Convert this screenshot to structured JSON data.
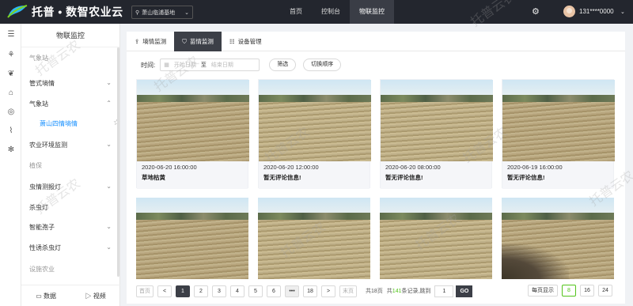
{
  "header": {
    "brand": "托普 • 数智农业云",
    "location": "萧山临浦基地",
    "nav": [
      "首页",
      "控制台",
      "物联监控"
    ],
    "user": "131****0000"
  },
  "sidebar": {
    "title": "物联监控",
    "items": [
      {
        "label": "气象站",
        "muted": true
      },
      {
        "label": "管式墒情",
        "arrow": "down"
      },
      {
        "label": "气象站",
        "arrow": "up"
      },
      {
        "label": "萧山四情墒情",
        "sub": true
      },
      {
        "label": "农业环境监测",
        "arrow": "down"
      },
      {
        "label": "植保",
        "muted": true
      },
      {
        "label": "虫情测报灯",
        "arrow": "down"
      },
      {
        "label": "杀虫灯"
      },
      {
        "label": "智能孢子",
        "arrow": "down"
      },
      {
        "label": "性诱杀虫灯",
        "arrow": "down"
      },
      {
        "label": "设施农业",
        "muted": true
      }
    ],
    "bottom": [
      "数据",
      "视频"
    ]
  },
  "tabs": [
    {
      "label": "墒情监测",
      "icon": "upload-icon"
    },
    {
      "label": "苗情监测",
      "icon": "shield-icon",
      "active": true
    },
    {
      "label": "设备管理",
      "icon": "list-icon"
    }
  ],
  "filter": {
    "time_label": "时间:",
    "start_placeholder": "开始日期",
    "to": "至",
    "end_placeholder": "结束日期",
    "filter_btn": "筛选",
    "order_btn": "切换顺序"
  },
  "cards": [
    {
      "date": "2020-06-20 16:00:00",
      "comment": "草地枯黄"
    },
    {
      "date": "2020-06-20 12:00:00",
      "comment": "暂无评论信息!"
    },
    {
      "date": "2020-06-20 08:00:00",
      "comment": "暂无评论信息!"
    },
    {
      "date": "2020-06-19 16:00:00",
      "comment": "暂无评论信息!"
    },
    {
      "date": "",
      "comment": ""
    },
    {
      "date": "",
      "comment": ""
    },
    {
      "date": "",
      "comment": ""
    },
    {
      "date": "",
      "comment": ""
    }
  ],
  "pager": {
    "first": "首页",
    "prev": "<",
    "pages": [
      "1",
      "2",
      "3",
      "4",
      "5",
      "6",
      "•••",
      "18"
    ],
    "next": ">",
    "last": "末页",
    "total_pages": "共18页",
    "total_records_prefix": "共",
    "total_records": "141",
    "total_records_suffix": "条记录,跳到",
    "jump_value": "1",
    "go": "GO",
    "per_page_label": "每页显示",
    "per_page_options": [
      "8",
      "16",
      "24"
    ],
    "per_page_selected": "8"
  },
  "watermark": "托普云农"
}
